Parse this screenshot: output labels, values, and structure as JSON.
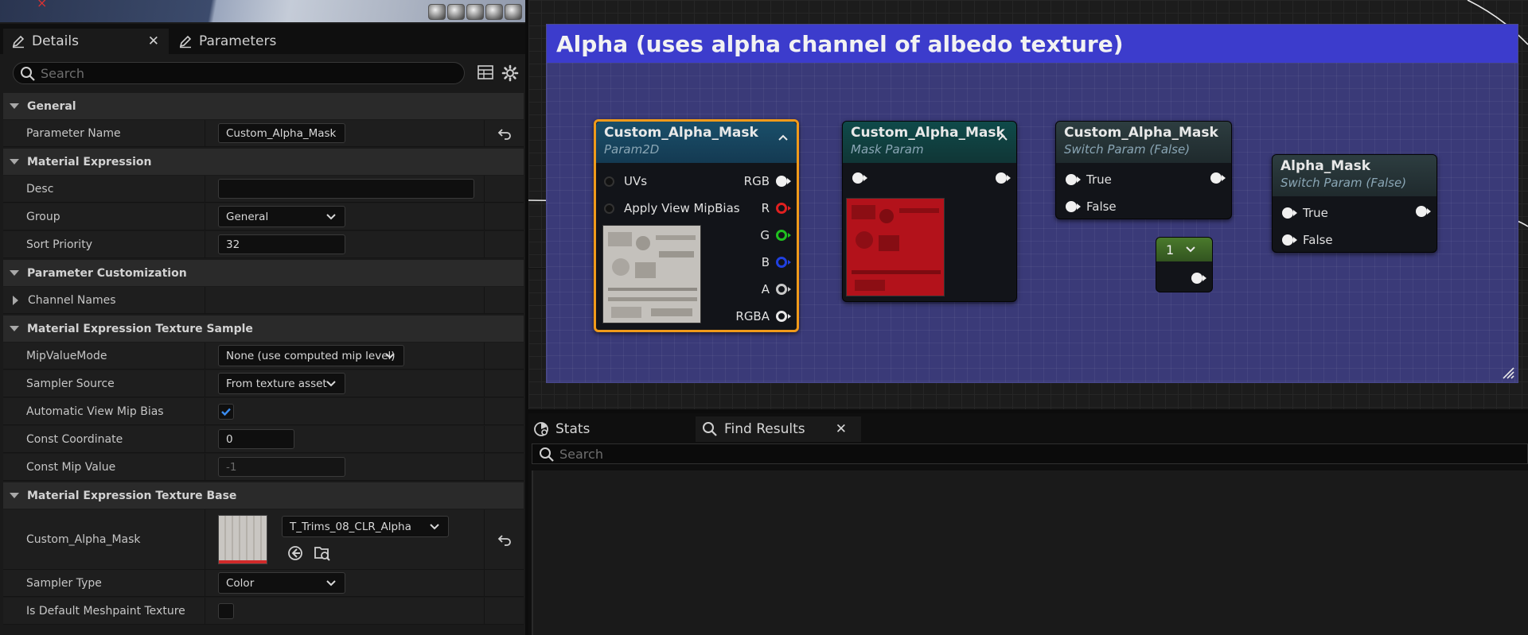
{
  "tabs": {
    "details": "Details",
    "parameters": "Parameters"
  },
  "search": {
    "placeholder": "Search"
  },
  "sections": {
    "general": "General",
    "material_expression": "Material Expression",
    "parameter_customization": "Parameter Customization",
    "texture_sample": "Material Expression Texture Sample",
    "texture_base": "Material Expression Texture Base"
  },
  "props": {
    "parameter_name": {
      "label": "Parameter Name",
      "value": "Custom_Alpha_Mask"
    },
    "desc": {
      "label": "Desc",
      "value": ""
    },
    "group": {
      "label": "Group",
      "value": "General"
    },
    "sort_priority": {
      "label": "Sort Priority",
      "value": "32"
    },
    "channel_names": {
      "label": "Channel Names"
    },
    "mip_value_mode": {
      "label": "MipValueMode",
      "value": "None (use computed mip level)"
    },
    "sampler_source": {
      "label": "Sampler Source",
      "value": "From texture asset"
    },
    "auto_view_mip_bias": {
      "label": "Automatic View Mip Bias",
      "checked": true
    },
    "const_coordinate": {
      "label": "Const Coordinate",
      "value": "0"
    },
    "const_mip_value": {
      "label": "Const Mip Value",
      "value": "-1"
    },
    "texture": {
      "label": "Custom_Alpha_Mask",
      "value": "T_Trims_08_CLR_Alpha"
    },
    "sampler_type": {
      "label": "Sampler Type",
      "value": "Color"
    },
    "default_meshpaint": {
      "label": "Is Default Meshpaint Texture",
      "checked": false
    }
  },
  "graph": {
    "comment": "Alpha (uses alpha channel of albedo texture)",
    "nodes": {
      "n1": {
        "title": "Custom_Alpha_Mask",
        "subtitle": "Param2D",
        "inputs": [
          "UVs",
          "Apply View MipBias"
        ],
        "outputs": [
          "RGB",
          "R",
          "G",
          "B",
          "A",
          "RGBA"
        ]
      },
      "n2": {
        "title": "Custom_Alpha_Mask",
        "subtitle": "Mask Param"
      },
      "n3": {
        "title": "Custom_Alpha_Mask",
        "subtitle": "Switch Param (False)",
        "inputs": [
          "True",
          "False"
        ]
      },
      "n4": {
        "title": "Alpha_Mask",
        "subtitle": "Switch Param (False)",
        "inputs": [
          "True",
          "False"
        ]
      },
      "const": {
        "value": "1"
      }
    }
  },
  "bottom": {
    "stats": "Stats",
    "find_results": "Find Results",
    "search_placeholder": "Search"
  },
  "colors": {
    "accent_selected": "#f09a1a",
    "comment_header": "#3c3ccc",
    "pin_r": "#e02020",
    "pin_g": "#20c020",
    "pin_b": "#2040e0"
  }
}
